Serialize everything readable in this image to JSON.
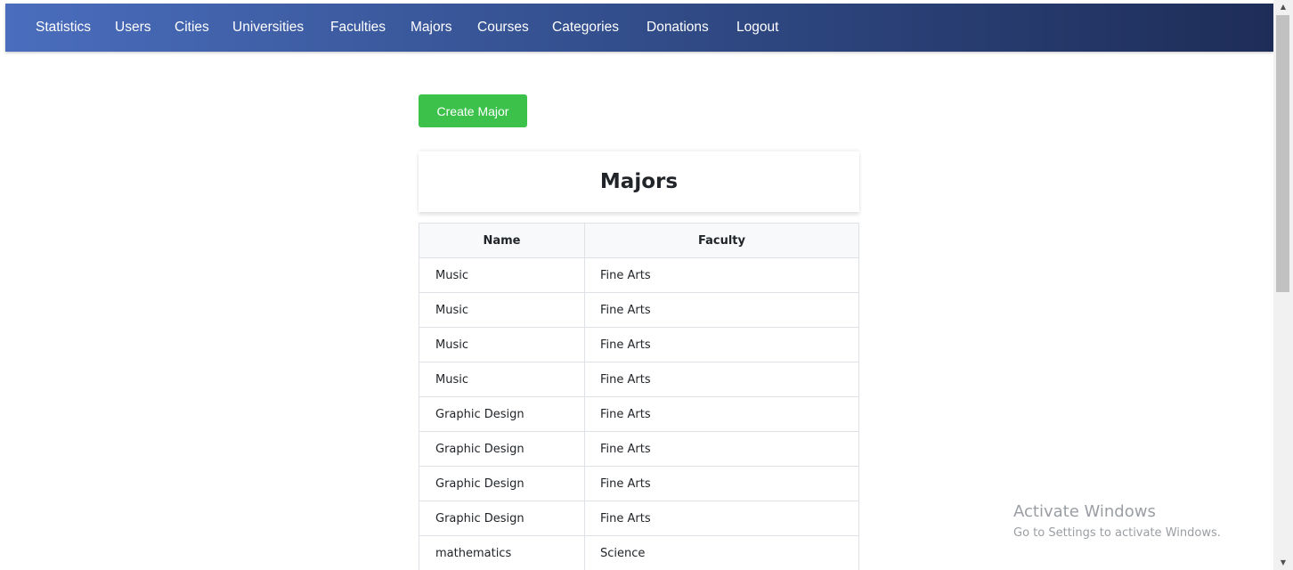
{
  "nav": {
    "items": [
      {
        "label": "Statistics"
      },
      {
        "label": "Users"
      },
      {
        "label": "Cities"
      },
      {
        "label": "Universities"
      },
      {
        "label": "Faculties"
      },
      {
        "label": "Majors"
      },
      {
        "label": "Courses"
      },
      {
        "label": "Categories"
      },
      {
        "label": "Donations"
      },
      {
        "label": "Logout"
      }
    ]
  },
  "actions": {
    "create_label": "Create Major"
  },
  "page": {
    "title": "Majors"
  },
  "table": {
    "headers": [
      "Name",
      "Faculty"
    ],
    "rows": [
      {
        "name": "Music",
        "faculty": "Fine Arts"
      },
      {
        "name": "Music",
        "faculty": "Fine Arts"
      },
      {
        "name": "Music",
        "faculty": "Fine Arts"
      },
      {
        "name": "Music",
        "faculty": "Fine Arts"
      },
      {
        "name": "Graphic Design",
        "faculty": "Fine Arts"
      },
      {
        "name": "Graphic Design",
        "faculty": "Fine Arts"
      },
      {
        "name": "Graphic Design",
        "faculty": "Fine Arts"
      },
      {
        "name": "Graphic Design",
        "faculty": "Fine Arts"
      },
      {
        "name": "mathematics",
        "faculty": "Science"
      }
    ]
  },
  "watermark": {
    "title": "Activate Windows",
    "subtitle": "Go to Settings to activate Windows."
  },
  "colors": {
    "nav_gradient_start": "#4a6dbd",
    "nav_gradient_end": "#1e2d58",
    "create_button": "#3cc14b"
  },
  "icons": {
    "scroll_up": "triangle-up-icon",
    "scroll_down": "triangle-down-icon"
  }
}
